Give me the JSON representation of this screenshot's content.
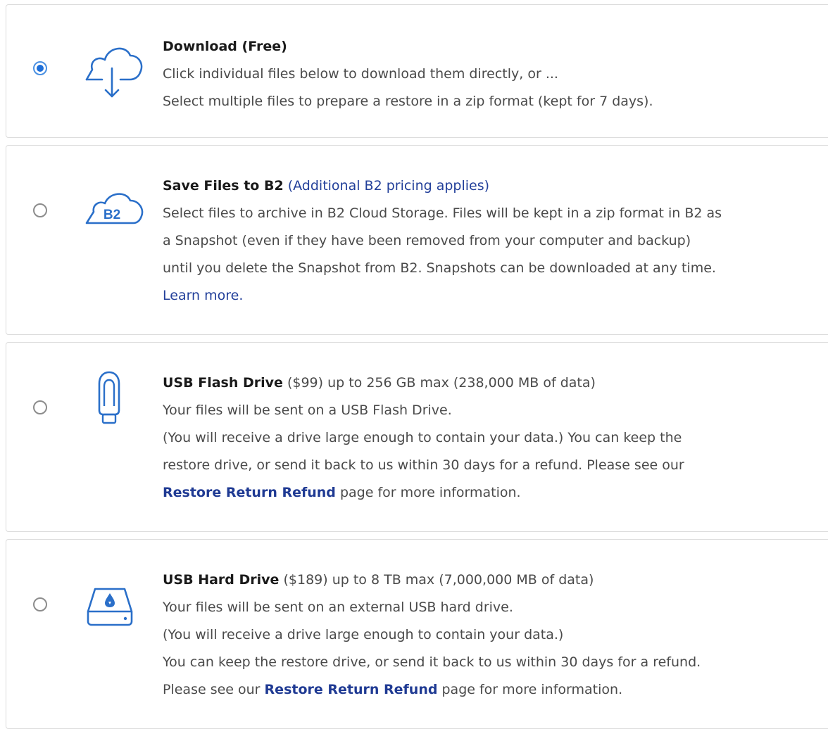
{
  "options": {
    "download": {
      "title": "Download (Free)",
      "line1": "Click individual files below to download them directly, or ...",
      "line2": "Select multiple files to prepare a restore in a zip format (kept for 7 days).",
      "selected": true,
      "icon": "cloud-download-icon"
    },
    "b2": {
      "title": "Save Files to B2",
      "pricing_link": "(Additional B2 pricing applies)",
      "line1": "Select files to archive in B2 Cloud Storage. Files will be kept in a zip format in B2 as",
      "line2": "a Snapshot (even if they have been removed from your computer and backup)",
      "line3": "until you delete the Snapshot from B2. Snapshots can be downloaded at any time.",
      "learn_more": "Learn more.",
      "icon_label": "B2",
      "selected": false,
      "icon": "b2-cloud-icon"
    },
    "usb_flash": {
      "title": "USB Flash Drive",
      "title_suffix": "($99) up to 256 GB max (238,000 MB of data)",
      "line1": "Your files will be sent on a USB Flash Drive.",
      "line2": "(You will receive a drive large enough to contain your data.) You can keep the",
      "line3": "restore drive, or send it back to us within 30 days for a refund. Please see our",
      "refund_link": "Restore Return Refund",
      "line4_suffix": " page for more information.",
      "selected": false,
      "icon": "usb-flash-drive-icon"
    },
    "usb_hard": {
      "title": "USB Hard Drive",
      "title_suffix": "($189) up to 8 TB max (7,000,000 MB of data)",
      "line1": "Your files will be sent on an external USB hard drive.",
      "line2": "(You will receive a drive large enough to contain your data.)",
      "line3": "You can keep the restore drive, or send it back to us within 30 days for a refund.",
      "line4_prefix": "Please see our ",
      "refund_link": "Restore Return Refund",
      "line4_suffix": " page for more information.",
      "selected": false,
      "icon": "usb-hard-drive-icon"
    }
  },
  "colors": {
    "accent": "#1e6fd9",
    "icon_stroke": "#2a6fc9",
    "link": "#1f3a93"
  }
}
